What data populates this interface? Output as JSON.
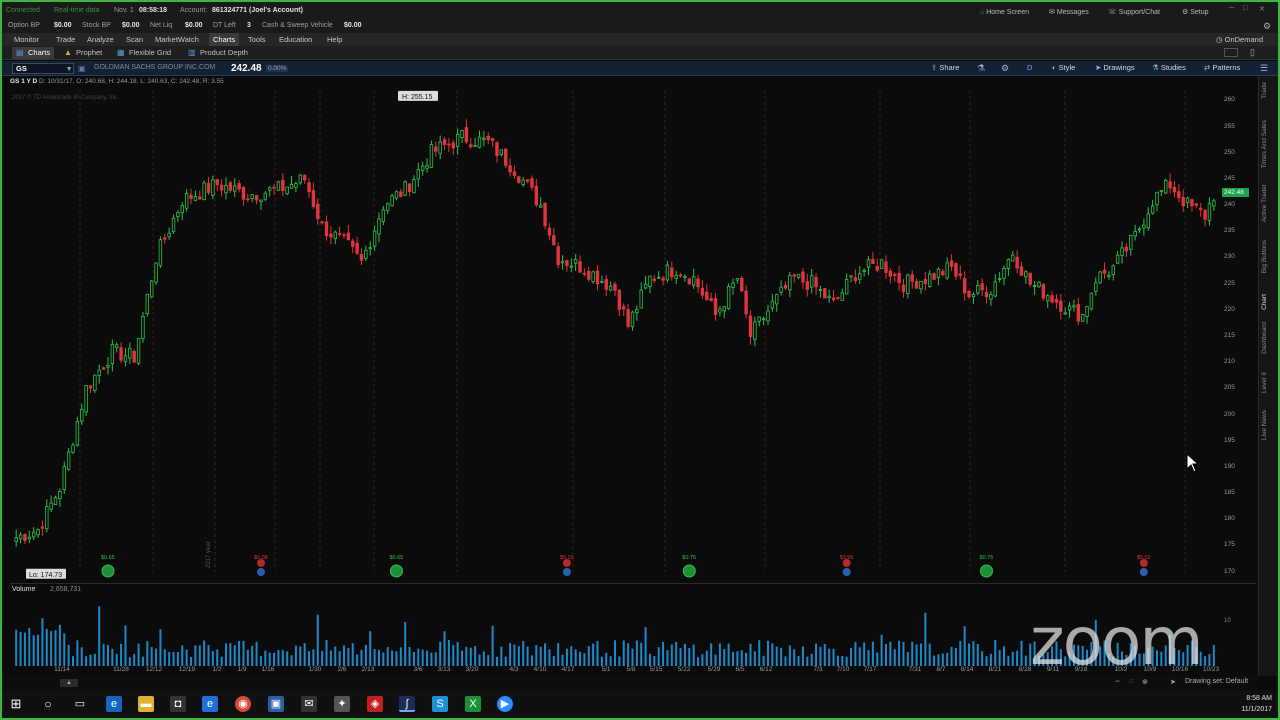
{
  "status_bar": {
    "connected": "Connected",
    "realtime": "Real-time data",
    "date": "Nov. 1",
    "time": "08:58:18",
    "account_label": "Account:",
    "account_value": "861324771 (Joel's Account)",
    "links": [
      "Home Screen",
      "Messages",
      "Support/Chat",
      "Setup"
    ]
  },
  "buying_power": [
    {
      "label": "Option BP",
      "value": "$0.00"
    },
    {
      "label": "Stock BP",
      "value": "$0.00"
    },
    {
      "label": "Net Liq",
      "value": "$0.00"
    },
    {
      "label": "DT Left",
      "value": "3"
    },
    {
      "label": "Cash & Sweep Vehicle",
      "value": "$0.00"
    }
  ],
  "main_menu": {
    "items": [
      "Monitor",
      "Trade",
      "Analyze",
      "Scan",
      "MarketWatch",
      "Charts",
      "Tools",
      "Education",
      "Help"
    ],
    "active": "Charts",
    "on_demand": "OnDemand"
  },
  "sub_menu": {
    "tabs": [
      "Charts",
      "Prophet",
      "Flexible Grid",
      "Product Depth"
    ],
    "active": "Charts"
  },
  "symbol_bar": {
    "symbol": "GS",
    "company": "GOLDMAN SACHS GROUP INC.COM",
    "last_price": "242.48",
    "change_pct": "0.00%",
    "aggregation": "D",
    "tools": [
      "Share",
      "Style",
      "Drawings",
      "Studies",
      "Patterns"
    ]
  },
  "info_line": {
    "period": "GS 1 Y D",
    "date": "D: 10/31/17",
    "open": "O: 240.68",
    "high": "H: 244.18",
    "low": "L: 240.63",
    "close": "C: 242.48",
    "range": "R: 3.55"
  },
  "copyright": "2017 © TD Ameritrade IP Company, Inc.",
  "volume_bar": {
    "label": "Volume",
    "value": "2,658,731"
  },
  "sidebar_tabs": [
    "Trade",
    "Times And Sales",
    "Active Trader",
    "Big Buttons",
    "Chart",
    "Dashboard",
    "Level II",
    "Live News"
  ],
  "bottom_toolbar": {
    "drawing_set": "Drawing set: Default"
  },
  "taskbar": {
    "time": "8:58 AM",
    "date": "11/1/2017"
  },
  "watermark": "zoom",
  "colors": {
    "up": "#2ec24a",
    "down": "#e0343f",
    "accent": "#1f6fd6",
    "frame": "#3fb53f"
  },
  "chart_data": {
    "type": "candlestick",
    "title": "GOLDMAN SACHS GROUP INC.COM",
    "symbol": "GS",
    "ylim": [
      168,
      262
    ],
    "y_ticks": [
      170,
      175,
      180,
      185,
      190,
      195,
      200,
      205,
      210,
      215,
      220,
      225,
      230,
      235,
      240,
      245,
      250,
      255,
      260
    ],
    "high_marker": "H: 255.15",
    "low_marker": "Lo: 174.73",
    "last_price": 242.48,
    "x_labels": [
      "11/14",
      "11/28",
      "12/12",
      "12/19",
      "1/2",
      "1/9",
      "1/16",
      "1/30",
      "2/6",
      "2/13",
      "3/6",
      "3/13",
      "3/20",
      "4/3",
      "4/10",
      "4/17",
      "5/1",
      "5/8",
      "5/15",
      "5/22",
      "5/29",
      "6/5",
      "6/12",
      "7/3",
      "7/10",
      "7/17",
      "7/31",
      "8/7",
      "8/14",
      "8/21",
      "8/28",
      "9/11",
      "9/18",
      "10/2",
      "10/9",
      "10/16",
      "10/23"
    ],
    "year_marker": "2017 year",
    "waypoints": [
      [
        0,
        176.5
      ],
      [
        5,
        178
      ],
      [
        10,
        186
      ],
      [
        16,
        205
      ],
      [
        22,
        212
      ],
      [
        27,
        211
      ],
      [
        32,
        230
      ],
      [
        38,
        241
      ],
      [
        46,
        244
      ],
      [
        53,
        242
      ],
      [
        60,
        243
      ],
      [
        66,
        245
      ],
      [
        70,
        236
      ],
      [
        76,
        232
      ],
      [
        79,
        229
      ],
      [
        84,
        240
      ],
      [
        89,
        243
      ],
      [
        95,
        250
      ],
      [
        102,
        253
      ],
      [
        108,
        252
      ],
      [
        114,
        247
      ],
      [
        120,
        240
      ],
      [
        124,
        230
      ],
      [
        130,
        228
      ],
      [
        137,
        224
      ],
      [
        140,
        217
      ],
      [
        145,
        226
      ],
      [
        151,
        228
      ],
      [
        155,
        226
      ],
      [
        160,
        219
      ],
      [
        165,
        226
      ],
      [
        168,
        215
      ],
      [
        173,
        221
      ],
      [
        178,
        226
      ],
      [
        182,
        225
      ],
      [
        187,
        221
      ],
      [
        192,
        227
      ],
      [
        198,
        229
      ],
      [
        203,
        225
      ],
      [
        208,
        226
      ],
      [
        214,
        228
      ],
      [
        218,
        223
      ],
      [
        223,
        224
      ],
      [
        228,
        231
      ],
      [
        232,
        225
      ],
      [
        236,
        223
      ],
      [
        241,
        220
      ],
      [
        244,
        219
      ],
      [
        247,
        226
      ],
      [
        251,
        228
      ],
      [
        256,
        234
      ],
      [
        260,
        241
      ],
      [
        264,
        244
      ],
      [
        268,
        240
      ],
      [
        272,
        238
      ],
      [
        274,
        242
      ]
    ],
    "events": [
      {
        "kind": "dividend",
        "label": "$0.65",
        "index": 21
      },
      {
        "kind": "earnings",
        "label": "$5.08",
        "index": 56
      },
      {
        "kind": "dividend",
        "label": "$0.65",
        "index": 87
      },
      {
        "kind": "earnings",
        "label": "$5.15",
        "index": 126
      },
      {
        "kind": "dividend",
        "label": "$0.75",
        "index": 154
      },
      {
        "kind": "earnings",
        "label": "$3.95",
        "index": 190
      },
      {
        "kind": "dividend",
        "label": "$0.75",
        "index": 222
      },
      {
        "kind": "earnings",
        "label": "$5.02",
        "index": 258
      }
    ],
    "volume_ylim": [
      0,
      16
    ],
    "volume_ticks": [
      10
    ]
  }
}
